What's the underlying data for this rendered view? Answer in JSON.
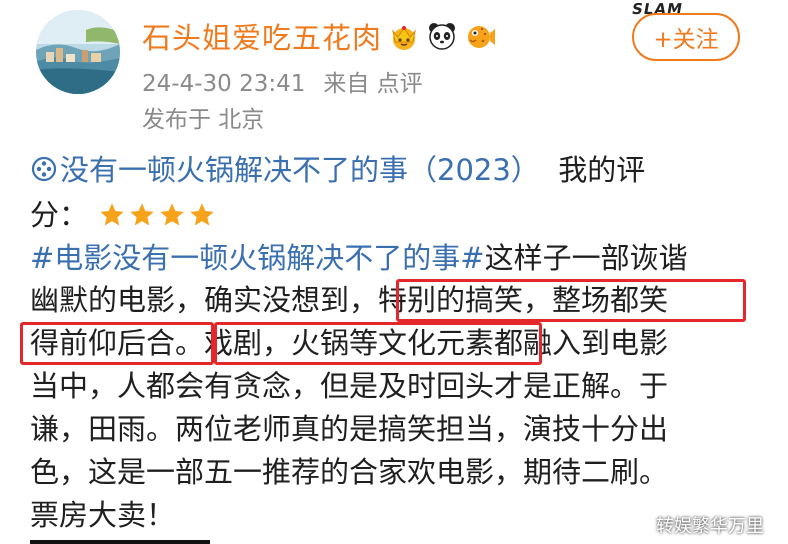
{
  "user": {
    "name": "石头姐爱吃五花肉",
    "badges": [
      "crown-badge-icon",
      "panda-badge-icon",
      "pufferfish-badge-icon"
    ]
  },
  "post_meta": {
    "time": "24-4-30 23:41",
    "source": "来自 点评",
    "location": "发布于 北京"
  },
  "follow_button": {
    "label": "+关注"
  },
  "corner_mark": "SLAM",
  "review": {
    "movie_title": "没有一顿火锅解决不了的事（2023）",
    "rating_label_a": "我的评",
    "rating_label_b": "分：",
    "rating_stars": 4,
    "hashtag": "#电影没有一顿火锅解决不了的事#",
    "text_1": "这样子一部诙谐",
    "text_2a": "幽默的电影，确实没想到，",
    "text_2b": "特别的搞笑，整场都笑",
    "text_3a": "得前仰后合。",
    "text_3b": "戏剧，火锅等文化元素",
    "text_3c": "都融入到电影",
    "text_4": "当中，人都会有贪念，但是及时回头才是正解。于",
    "text_5": "谦，田雨。两位老师真的是搞笑担当，演技十分出",
    "text_6": "色，这是一部五一推荐的合家欢电影，期待二刷。",
    "text_7": "票房大卖！"
  },
  "watermark": "转娱繁华万里",
  "colors": {
    "username": "#f07a1e",
    "link": "#3a6fb0",
    "highlight_box": "#e5262b",
    "meta": "#8a8a8a",
    "star": "#f7a21b"
  }
}
